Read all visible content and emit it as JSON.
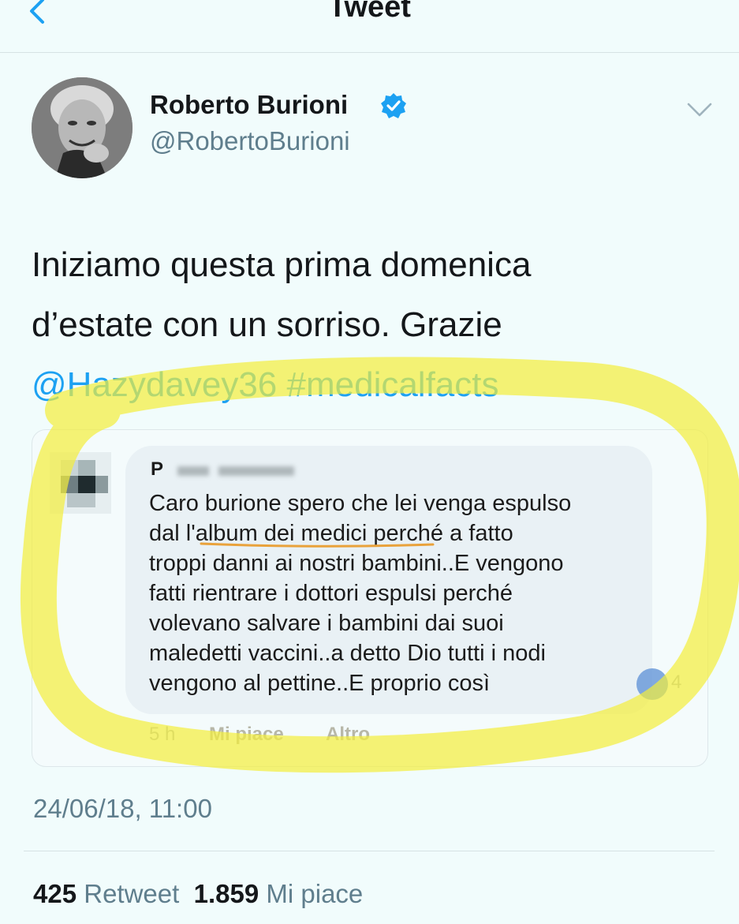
{
  "header": {
    "title": "Tweet",
    "back_icon": "chevron-left-icon",
    "accent": "#1da1f2"
  },
  "author": {
    "name": "Roberto Burioni",
    "handle": "@RobertoBurioni",
    "verified_icon": "verified-badge-icon",
    "menu_icon": "chevron-down-icon"
  },
  "tweet": {
    "line1": "Iniziamo questa prima domenica",
    "line2": "d’estate con un sorriso. Grazie",
    "mention": "@Hazydavey36",
    "hashtag": "#medicalfacts"
  },
  "embedded_comment": {
    "commenter_initial": "P",
    "lines": [
      "Caro burione spero che lei venga espulso",
      "dal l'album dei medici perché a fatto",
      "troppi danni ai nostri bambini..E vengono",
      "fatti rientrare i dottori espulsi perché",
      "volevano salvare i bambini dai suoi",
      "maledetti vaccini..a detto Dio tutti i nodi",
      "vengono al pettine..E proprio così"
    ],
    "reaction_count": "4",
    "time": "5 h",
    "like_label": "Mi piace",
    "more_label": "Altro",
    "underline_color": "#e9a23b",
    "highlight_color": "#f3ee3a"
  },
  "timestamp": "24/06/18, 11:00",
  "stats": {
    "retweets": "425",
    "retweets_label": "Retweet",
    "likes": "1.859",
    "likes_label": "Mi piace"
  }
}
